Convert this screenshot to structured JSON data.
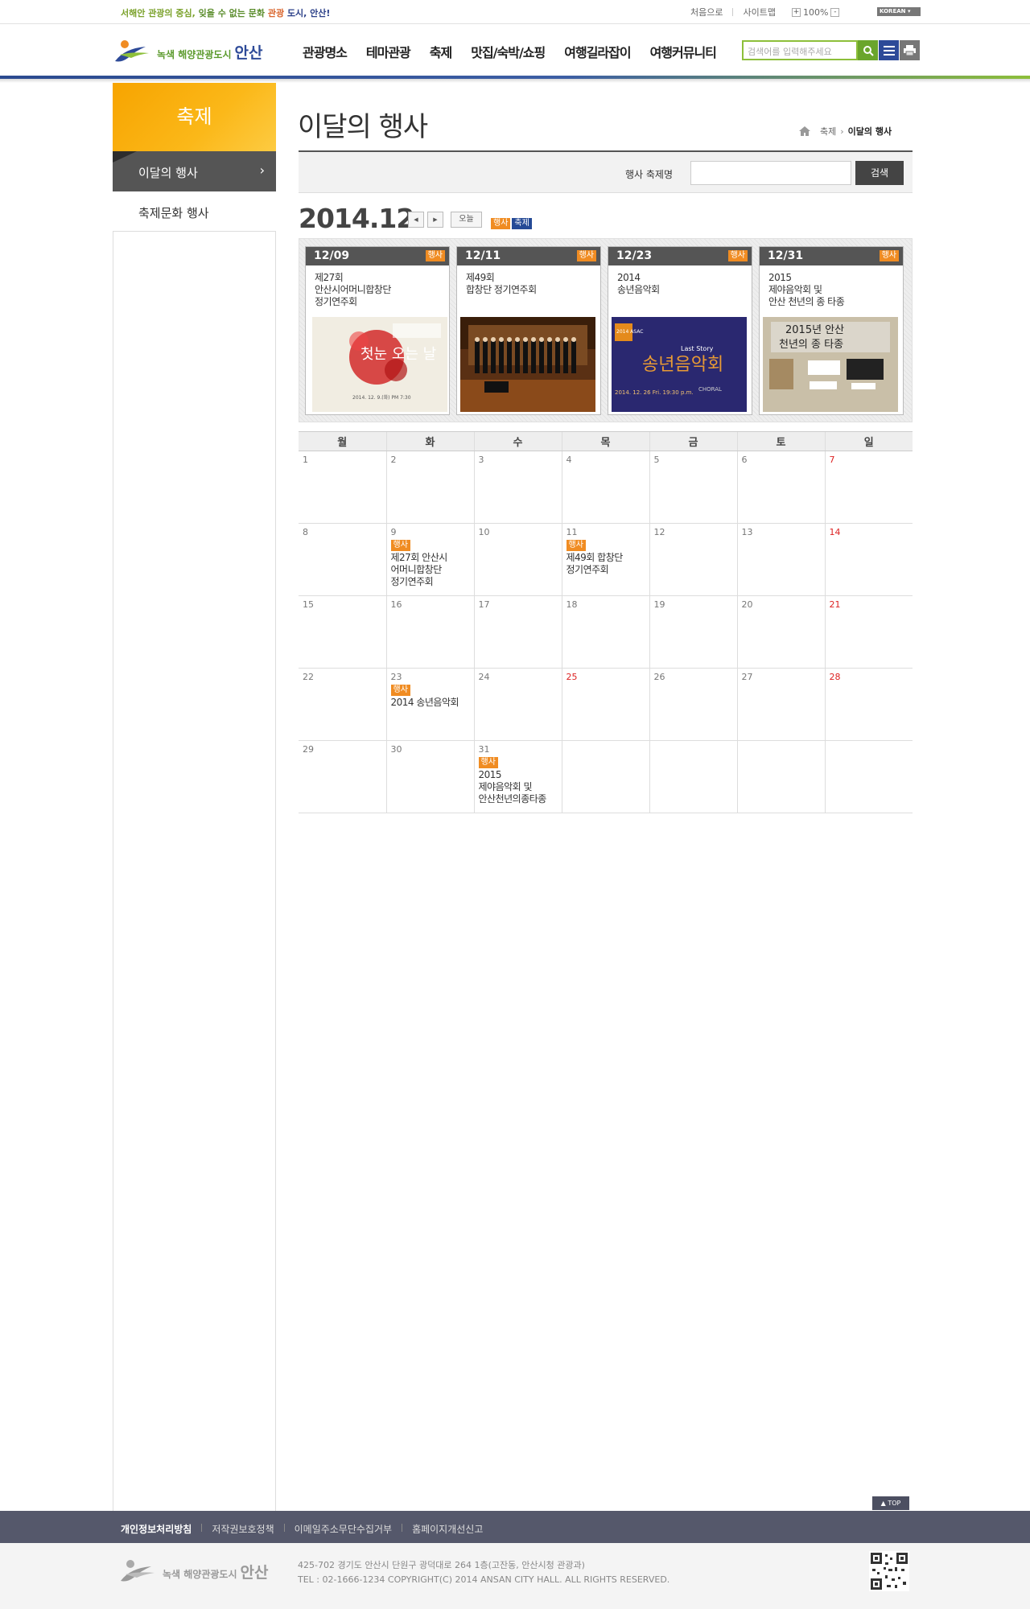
{
  "topbar": {
    "slogan_1": "서해안 관광의 중심,",
    "slogan_2": "잊을 수 없는 문화",
    "slogan_3": "관광",
    "slogan_4": "도시, 안산!",
    "home": "처음으로",
    "sitemap": "사이트맵",
    "zoom_plus": "+",
    "zoom": "100%",
    "zoom_minus": "-",
    "lang": "KOREAN"
  },
  "header": {
    "logo_small": "녹색 해양관광도시",
    "logo_city": "안산",
    "nav": [
      "관광명소",
      "테마관광",
      "축제",
      "맛집/숙박/쇼핑",
      "여행길라잡이",
      "여행커뮤니티"
    ],
    "search_placeholder": "검색어를 입력해주세요"
  },
  "sidebar": {
    "title": "축제",
    "items": [
      {
        "label": "이달의 행사",
        "active": true
      },
      {
        "label": "축제문화 행사",
        "active": false
      }
    ]
  },
  "page": {
    "title": "이달의 행사",
    "breadcrumb": [
      "축제",
      "이달의 행사"
    ]
  },
  "search_box": {
    "label": "행사 축제명",
    "value": "",
    "button": "검색"
  },
  "calendar_nav": {
    "month": "2014.12",
    "prev": "◀",
    "next": "▶",
    "today": "오늘",
    "legend_event": "행사",
    "legend_festival": "축제"
  },
  "cards": [
    {
      "date": "12/09",
      "tag": "행사",
      "title_1": "제27회",
      "title_2": "안산시어머니합창단",
      "title_3": "정기연주회"
    },
    {
      "date": "12/11",
      "tag": "행사",
      "title_1": "제49회",
      "title_2": "합창단 정기연주회",
      "title_3": ""
    },
    {
      "date": "12/23",
      "tag": "행사",
      "title_1": "2014",
      "title_2": "송년음악회",
      "title_3": ""
    },
    {
      "date": "12/31",
      "tag": "행사",
      "title_1": "2015",
      "title_2": "제야음악회 및",
      "title_3": "안산 천년의 종 타종"
    }
  ],
  "poster_text": {
    "p1_title": "첫눈 오는 날",
    "p1_date": "2014. 12. 9.(화) PM 7:30",
    "p3_badge": "2014 ASAC",
    "p3_title": "송년음악회",
    "p3_sub": "Last Story",
    "p3_date": "2014. 12. 26 Fri. 19:30 p.m.",
    "p3_choral": "CHORAL",
    "p4_title_1": "2015년 안산",
    "p4_title_2": "천년의 종 타종"
  },
  "weekdays": [
    "월",
    "화",
    "수",
    "목",
    "금",
    "토",
    "일"
  ],
  "weeks": [
    [
      {
        "d": "1"
      },
      {
        "d": "2"
      },
      {
        "d": "3"
      },
      {
        "d": "4"
      },
      {
        "d": "5"
      },
      {
        "d": "6"
      },
      {
        "d": "7",
        "sun": true
      }
    ],
    [
      {
        "d": "8"
      },
      {
        "d": "9",
        "tag": "행사",
        "t1": "제27회 안산시",
        "t2": "어머니합창단",
        "t3": "정기연주회"
      },
      {
        "d": "10"
      },
      {
        "d": "11",
        "tag": "행사",
        "t1": "제49회 합창단",
        "t2": "정기연주회"
      },
      {
        "d": "12"
      },
      {
        "d": "13"
      },
      {
        "d": "14",
        "sun": true
      }
    ],
    [
      {
        "d": "15"
      },
      {
        "d": "16"
      },
      {
        "d": "17"
      },
      {
        "d": "18"
      },
      {
        "d": "19"
      },
      {
        "d": "20"
      },
      {
        "d": "21",
        "sun": true
      }
    ],
    [
      {
        "d": "22"
      },
      {
        "d": "23",
        "tag": "행사",
        "t1": "2014 송년음악회"
      },
      {
        "d": "24"
      },
      {
        "d": "25",
        "sun": true
      },
      {
        "d": "26"
      },
      {
        "d": "27"
      },
      {
        "d": "28",
        "sun": true
      }
    ],
    [
      {
        "d": "29"
      },
      {
        "d": "30"
      },
      {
        "d": "31",
        "tag": "행사",
        "t1": "2015",
        "t2": "제야음악회 및",
        "t3": "안산천년의종타종"
      },
      {
        "d": ""
      },
      {
        "d": ""
      },
      {
        "d": ""
      },
      {
        "d": ""
      }
    ]
  ],
  "footer": {
    "top_button": "▲ TOP",
    "links": [
      "개인정보처리방침",
      "저작권보호정책",
      "이메일주소무단수집거부",
      "홈페이지개선신고"
    ],
    "logo_small": "녹색 해양관광도시",
    "logo_city": "안산",
    "address": "425-702  경기도 안산시 단원구 광덕대로 264 1층(고잔동, 안산시청 관광과)",
    "contact": "TEL : 02-1666-1234   COPYRIGHT(C) 2014 ANSAN CITY HALL. ALL RIGHTS RESERVED."
  },
  "colors": {
    "accent_orange": "#f08c22",
    "accent_blue": "#254a96",
    "sidebar_yellow": "#fbb819",
    "footer_bg": "#55586b"
  }
}
